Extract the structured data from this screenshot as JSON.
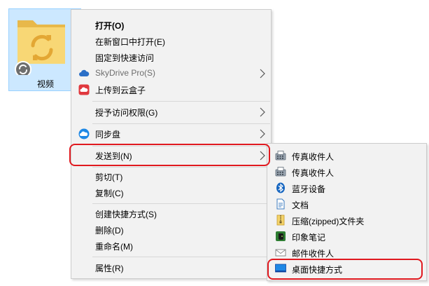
{
  "desktop": {
    "folder_label": "视频"
  },
  "context_menu": {
    "items": [
      {
        "label": "打开(O)"
      },
      {
        "label": "在新窗口中打开(E)"
      },
      {
        "label": "固定到快速访问"
      },
      {
        "label": "SkyDrive Pro(S)"
      },
      {
        "label": "上传到云盒子"
      },
      {
        "label": "授予访问权限(G)"
      },
      {
        "label": "同步盘"
      },
      {
        "label": "发送到(N)"
      },
      {
        "label": "剪切(T)"
      },
      {
        "label": "复制(C)"
      },
      {
        "label": "创建快捷方式(S)"
      },
      {
        "label": "删除(D)"
      },
      {
        "label": "重命名(M)"
      },
      {
        "label": "属性(R)"
      }
    ]
  },
  "send_to_submenu": {
    "items": [
      {
        "label": "传真收件人",
        "icon": "fax-icon"
      },
      {
        "label": "传真收件人",
        "icon": "fax-icon"
      },
      {
        "label": "蓝牙设备",
        "icon": "bluetooth-icon"
      },
      {
        "label": "文档",
        "icon": "document-icon"
      },
      {
        "label": "压缩(zipped)文件夹",
        "icon": "zip-folder-icon"
      },
      {
        "label": "印象笔记",
        "icon": "evernote-icon"
      },
      {
        "label": "邮件收件人",
        "icon": "mail-icon"
      },
      {
        "label": "桌面快捷方式",
        "icon": "desktop-icon"
      }
    ]
  },
  "colors": {
    "highlight_ring": "#e0191f",
    "folder_selection": "#cce8ff",
    "menu_background": "#f2f2f2"
  }
}
